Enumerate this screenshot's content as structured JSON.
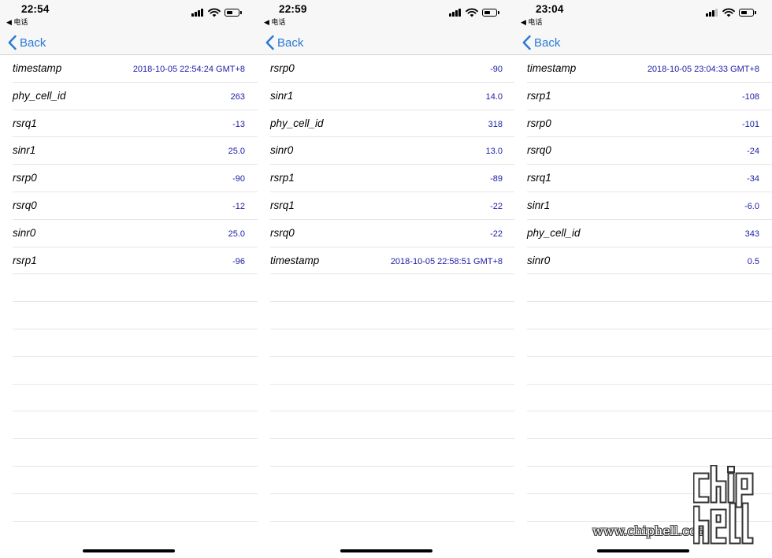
{
  "back_label": "Back",
  "phones": [
    {
      "time": "22:54",
      "back_app": "◀ 电话",
      "rows": [
        {
          "key": "timestamp",
          "value": "2018-10-05 22:54:24 GMT+8"
        },
        {
          "key": "phy_cell_id",
          "value": "263"
        },
        {
          "key": "rsrq1",
          "value": "-13"
        },
        {
          "key": "sinr1",
          "value": "25.0"
        },
        {
          "key": "rsrp0",
          "value": "-90"
        },
        {
          "key": "rsrq0",
          "value": "-12"
        },
        {
          "key": "sinr0",
          "value": "25.0"
        },
        {
          "key": "rsrp1",
          "value": "-96"
        },
        {
          "key": "",
          "value": ""
        },
        {
          "key": "",
          "value": ""
        },
        {
          "key": "",
          "value": ""
        },
        {
          "key": "",
          "value": ""
        },
        {
          "key": "",
          "value": ""
        },
        {
          "key": "",
          "value": ""
        },
        {
          "key": "",
          "value": ""
        },
        {
          "key": "",
          "value": ""
        },
        {
          "key": "",
          "value": ""
        },
        {
          "key": "",
          "value": ""
        }
      ]
    },
    {
      "time": "22:59",
      "back_app": "◀ 电话",
      "rows": [
        {
          "key": "rsrp0",
          "value": "-90"
        },
        {
          "key": "sinr1",
          "value": "14.0"
        },
        {
          "key": "phy_cell_id",
          "value": "318"
        },
        {
          "key": "sinr0",
          "value": "13.0"
        },
        {
          "key": "rsrp1",
          "value": "-89"
        },
        {
          "key": "rsrq1",
          "value": "-22"
        },
        {
          "key": "rsrq0",
          "value": "-22"
        },
        {
          "key": "timestamp",
          "value": "2018-10-05 22:58:51 GMT+8"
        },
        {
          "key": "",
          "value": ""
        },
        {
          "key": "",
          "value": ""
        },
        {
          "key": "",
          "value": ""
        },
        {
          "key": "",
          "value": ""
        },
        {
          "key": "",
          "value": ""
        },
        {
          "key": "",
          "value": ""
        },
        {
          "key": "",
          "value": ""
        },
        {
          "key": "",
          "value": ""
        },
        {
          "key": "",
          "value": ""
        },
        {
          "key": "",
          "value": ""
        }
      ]
    },
    {
      "time": "23:04",
      "back_app": "◀ 电话",
      "rows": [
        {
          "key": "timestamp",
          "value": "2018-10-05 23:04:33 GMT+8"
        },
        {
          "key": "rsrp1",
          "value": "-108"
        },
        {
          "key": "rsrp0",
          "value": "-101"
        },
        {
          "key": "rsrq0",
          "value": "-24"
        },
        {
          "key": "rsrq1",
          "value": "-34"
        },
        {
          "key": "sinr1",
          "value": "-6.0"
        },
        {
          "key": "phy_cell_id",
          "value": "343"
        },
        {
          "key": "sinr0",
          "value": "0.5"
        },
        {
          "key": "",
          "value": ""
        },
        {
          "key": "",
          "value": ""
        },
        {
          "key": "",
          "value": ""
        },
        {
          "key": "",
          "value": ""
        },
        {
          "key": "",
          "value": ""
        },
        {
          "key": "",
          "value": ""
        },
        {
          "key": "",
          "value": ""
        },
        {
          "key": "",
          "value": ""
        },
        {
          "key": "",
          "value": ""
        },
        {
          "key": "",
          "value": ""
        }
      ]
    }
  ],
  "watermark": {
    "text": "www.chiphell.com",
    "logo_letters": "chip hell"
  },
  "colors": {
    "accent": "#2a78d6",
    "value_text": "#1c1ca6",
    "bar_background": "#f7f7f7",
    "separator": "#e6e6e8"
  },
  "icons": {
    "back": "chevron-left-icon",
    "signal": "cellular-signal-icon",
    "wifi": "wifi-icon",
    "battery": "battery-icon"
  }
}
